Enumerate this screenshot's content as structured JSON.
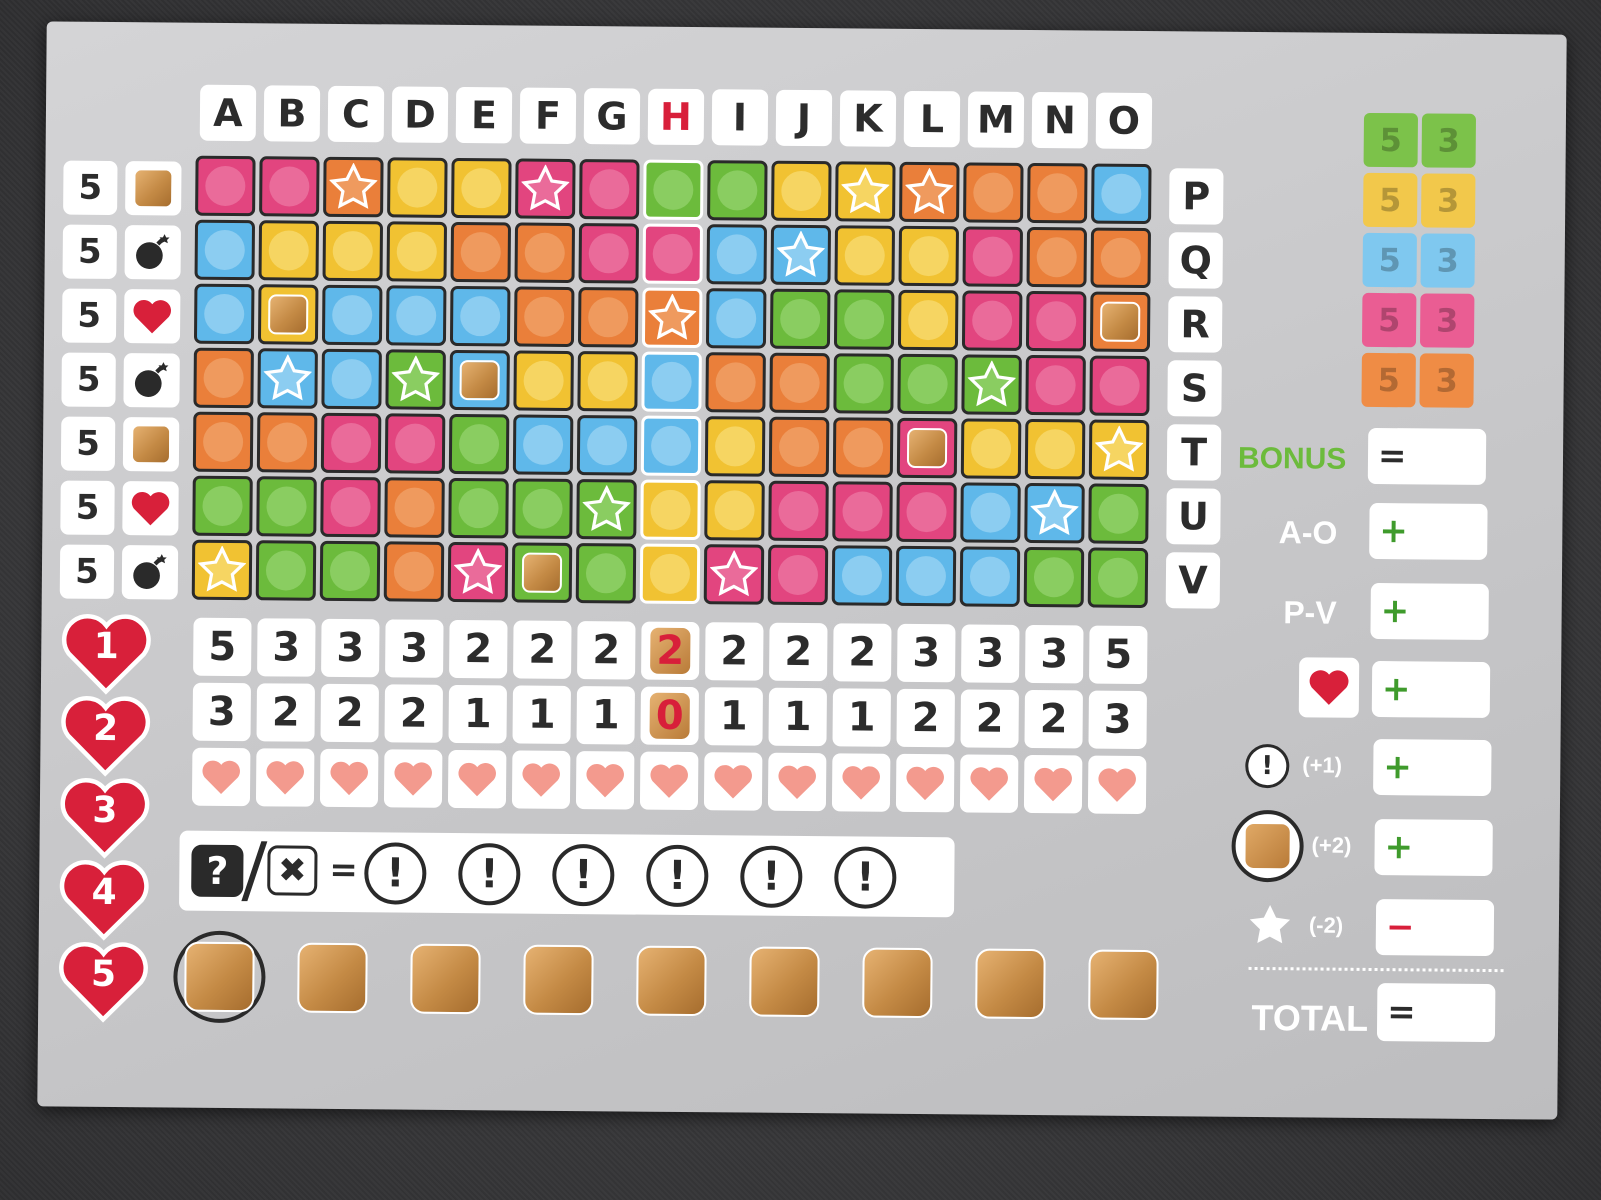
{
  "columns": [
    "A",
    "B",
    "C",
    "D",
    "E",
    "F",
    "G",
    "H",
    "I",
    "J",
    "K",
    "L",
    "M",
    "N",
    "O"
  ],
  "highlight_column": "H",
  "rows": [
    "P",
    "Q",
    "R",
    "S",
    "T",
    "U",
    "V"
  ],
  "row_points": [
    "5",
    "5",
    "5",
    "5",
    "5",
    "5",
    "5"
  ],
  "row_icons": [
    "crate-icon",
    "bomb-icon",
    "heart-icon",
    "bomb-icon",
    "crate-icon",
    "heart-icon",
    "bomb-icon"
  ],
  "grid": [
    [
      [
        "pink",
        ""
      ],
      [
        "pink",
        ""
      ],
      [
        "orange",
        "star"
      ],
      [
        "yellow",
        ""
      ],
      [
        "yellow",
        ""
      ],
      [
        "pink",
        "star"
      ],
      [
        "pink",
        ""
      ],
      [
        "green",
        ""
      ],
      [
        "green",
        ""
      ],
      [
        "yellow",
        ""
      ],
      [
        "yellow",
        "star"
      ],
      [
        "orange",
        "star"
      ],
      [
        "orange",
        ""
      ],
      [
        "orange",
        ""
      ],
      [
        "blue",
        ""
      ]
    ],
    [
      [
        "blue",
        ""
      ],
      [
        "yellow",
        ""
      ],
      [
        "yellow",
        ""
      ],
      [
        "yellow",
        ""
      ],
      [
        "orange",
        ""
      ],
      [
        "orange",
        ""
      ],
      [
        "pink",
        ""
      ],
      [
        "pink",
        ""
      ],
      [
        "blue",
        ""
      ],
      [
        "blue",
        "star"
      ],
      [
        "yellow",
        ""
      ],
      [
        "yellow",
        ""
      ],
      [
        "pink",
        ""
      ],
      [
        "orange",
        ""
      ],
      [
        "orange",
        ""
      ]
    ],
    [
      [
        "blue",
        ""
      ],
      [
        "yellow",
        "crate"
      ],
      [
        "blue",
        ""
      ],
      [
        "blue",
        ""
      ],
      [
        "blue",
        ""
      ],
      [
        "orange",
        ""
      ],
      [
        "orange",
        ""
      ],
      [
        "orange",
        "star"
      ],
      [
        "blue",
        ""
      ],
      [
        "green",
        ""
      ],
      [
        "green",
        ""
      ],
      [
        "yellow",
        ""
      ],
      [
        "pink",
        ""
      ],
      [
        "pink",
        ""
      ],
      [
        "orange",
        "crate"
      ]
    ],
    [
      [
        "orange",
        ""
      ],
      [
        "blue",
        "star"
      ],
      [
        "blue",
        ""
      ],
      [
        "green",
        "star"
      ],
      [
        "blue",
        "crate"
      ],
      [
        "yellow",
        ""
      ],
      [
        "yellow",
        ""
      ],
      [
        "blue",
        ""
      ],
      [
        "orange",
        ""
      ],
      [
        "orange",
        ""
      ],
      [
        "green",
        ""
      ],
      [
        "green",
        ""
      ],
      [
        "green",
        "star"
      ],
      [
        "pink",
        ""
      ],
      [
        "pink",
        ""
      ]
    ],
    [
      [
        "orange",
        ""
      ],
      [
        "orange",
        ""
      ],
      [
        "pink",
        ""
      ],
      [
        "pink",
        ""
      ],
      [
        "green",
        ""
      ],
      [
        "blue",
        ""
      ],
      [
        "blue",
        ""
      ],
      [
        "blue",
        ""
      ],
      [
        "yellow",
        ""
      ],
      [
        "orange",
        ""
      ],
      [
        "orange",
        ""
      ],
      [
        "pink",
        "crate"
      ],
      [
        "yellow",
        ""
      ],
      [
        "yellow",
        ""
      ],
      [
        "yellow",
        "star"
      ]
    ],
    [
      [
        "green",
        ""
      ],
      [
        "green",
        ""
      ],
      [
        "pink",
        ""
      ],
      [
        "orange",
        ""
      ],
      [
        "green",
        ""
      ],
      [
        "green",
        ""
      ],
      [
        "green",
        "star"
      ],
      [
        "yellow",
        ""
      ],
      [
        "yellow",
        ""
      ],
      [
        "pink",
        ""
      ],
      [
        "pink",
        ""
      ],
      [
        "pink",
        ""
      ],
      [
        "blue",
        ""
      ],
      [
        "blue",
        "star"
      ],
      [
        "green",
        ""
      ]
    ],
    [
      [
        "yellow",
        "star"
      ],
      [
        "green",
        ""
      ],
      [
        "green",
        ""
      ],
      [
        "orange",
        ""
      ],
      [
        "pink",
        "star"
      ],
      [
        "green",
        "crate"
      ],
      [
        "green",
        ""
      ],
      [
        "yellow",
        ""
      ],
      [
        "pink",
        "star"
      ],
      [
        "pink",
        ""
      ],
      [
        "blue",
        ""
      ],
      [
        "blue",
        ""
      ],
      [
        "blue",
        ""
      ],
      [
        "green",
        ""
      ],
      [
        "green",
        ""
      ]
    ]
  ],
  "first_scores": [
    "5",
    "3",
    "3",
    "3",
    "2",
    "2",
    "2",
    "2",
    "2",
    "2",
    "2",
    "3",
    "3",
    "3",
    "5"
  ],
  "second_scores": [
    "3",
    "2",
    "2",
    "2",
    "1",
    "1",
    "1",
    "0",
    "1",
    "1",
    "1",
    "2",
    "2",
    "2",
    "3"
  ],
  "life_hearts": [
    "1",
    "2",
    "3",
    "4",
    "5"
  ],
  "color_bonus": [
    {
      "color": "#7cc24a",
      "first": "5",
      "second": "3"
    },
    {
      "color": "#f2c84b",
      "first": "5",
      "second": "3"
    },
    {
      "color": "#7fc8ef",
      "first": "5",
      "second": "3"
    },
    {
      "color": "#ea5d93",
      "first": "5",
      "second": "3"
    },
    {
      "color": "#ef8c45",
      "first": "5",
      "second": "3"
    }
  ],
  "joker_row": {
    "eq": "=",
    "count": 6
  },
  "crate_track_count": 9,
  "scoring": {
    "bonus_label": "BONUS",
    "bonus_op": "=",
    "cols_label": "A-O",
    "cols_op": "+",
    "rows_label": "P-V",
    "rows_op": "+",
    "heart_op": "+",
    "joker_mod": "(+1)",
    "joker_op": "+",
    "crate_mod": "(+2)",
    "crate_op": "+",
    "star_mod": "(-2)",
    "star_op": "−",
    "total_label": "TOTAL",
    "total_op": "="
  },
  "colors": {
    "pink": "#e2457f",
    "orange": "#ea7f3a",
    "yellow": "#f1c232",
    "green": "#6cbb3c",
    "blue": "#5fb8ea",
    "heart_red": "#d8203a",
    "crate": "#c98e4d"
  }
}
